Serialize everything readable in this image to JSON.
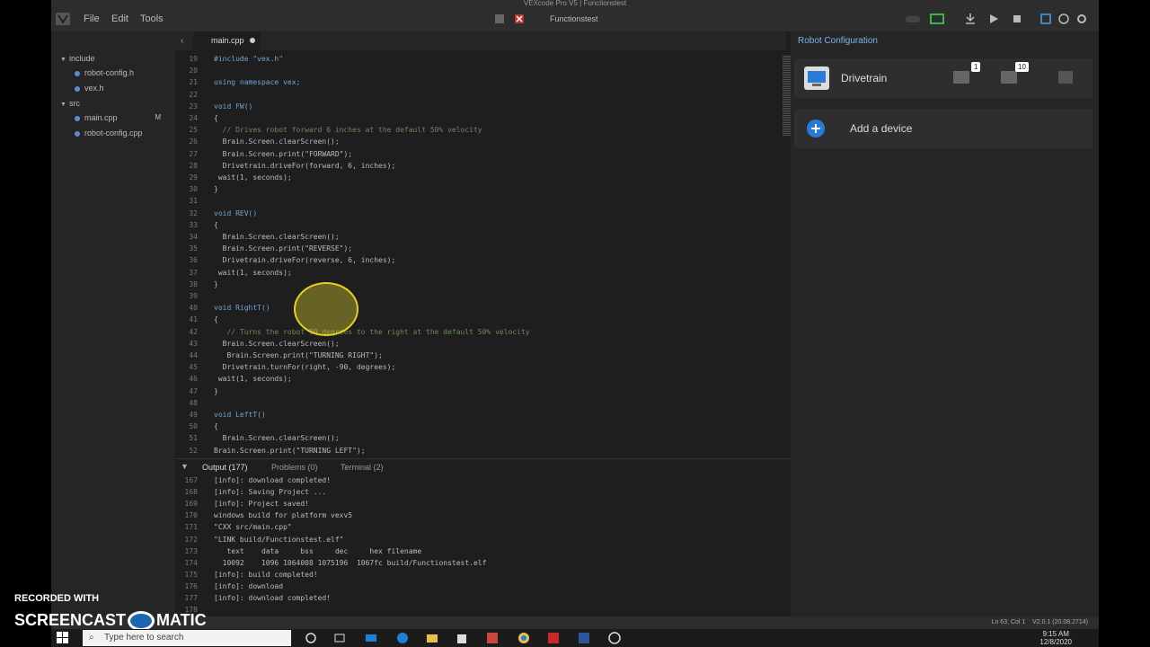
{
  "window": {
    "title": "VEXcode Pro V5 | Functionstest",
    "project_name": "Functionstest"
  },
  "menu": {
    "file": "File",
    "edit": "Edit",
    "tools": "Tools"
  },
  "sidebar": {
    "items": [
      {
        "label": "include",
        "type": "folder"
      },
      {
        "label": "robot-config.h",
        "type": "file"
      },
      {
        "label": "vex.h",
        "type": "file"
      },
      {
        "label": "src",
        "type": "folder"
      },
      {
        "label": "main.cpp",
        "type": "file",
        "badge": "M"
      },
      {
        "label": "robot-config.cpp",
        "type": "file"
      }
    ]
  },
  "editor": {
    "tab_label": "main.cpp",
    "lines": [
      {
        "n": "19",
        "text": "#include \"vex.h\""
      },
      {
        "n": "20",
        "text": ""
      },
      {
        "n": "21",
        "text": "using namespace vex;"
      },
      {
        "n": "22",
        "text": ""
      },
      {
        "n": "23",
        "text": "void FW()"
      },
      {
        "n": "24",
        "text": "{"
      },
      {
        "n": "25",
        "text": "  // Drives robot forward 6 inches at the default 50% velocity"
      },
      {
        "n": "26",
        "text": "  Brain.Screen.clearScreen();"
      },
      {
        "n": "27",
        "text": "  Brain.Screen.print(\"FORWARD\");"
      },
      {
        "n": "28",
        "text": "  Drivetrain.driveFor(forward, 6, inches);"
      },
      {
        "n": "29",
        "text": " wait(1, seconds);"
      },
      {
        "n": "30",
        "text": "}"
      },
      {
        "n": "31",
        "text": ""
      },
      {
        "n": "32",
        "text": "void REV()"
      },
      {
        "n": "33",
        "text": "{"
      },
      {
        "n": "34",
        "text": "  Brain.Screen.clearScreen();"
      },
      {
        "n": "35",
        "text": "  Brain.Screen.print(\"REVERSE\");"
      },
      {
        "n": "36",
        "text": "  Drivetrain.driveFor(reverse, 6, inches);"
      },
      {
        "n": "37",
        "text": " wait(1, seconds);"
      },
      {
        "n": "38",
        "text": "}"
      },
      {
        "n": "39",
        "text": ""
      },
      {
        "n": "40",
        "text": "void RightT()"
      },
      {
        "n": "41",
        "text": "{"
      },
      {
        "n": "42",
        "text": "   // Turns the robot 90 degrees to the right at the default 50% velocity"
      },
      {
        "n": "43",
        "text": "  Brain.Screen.clearScreen();"
      },
      {
        "n": "44",
        "text": "   Brain.Screen.print(\"TURNING RIGHT\");"
      },
      {
        "n": "45",
        "text": "  Drivetrain.turnFor(right, -90, degrees);"
      },
      {
        "n": "46",
        "text": " wait(1, seconds);"
      },
      {
        "n": "47",
        "text": "}"
      },
      {
        "n": "48",
        "text": ""
      },
      {
        "n": "49",
        "text": "void LeftT()"
      },
      {
        "n": "50",
        "text": "{"
      },
      {
        "n": "51",
        "text": "  Brain.Screen.clearScreen();"
      },
      {
        "n": "52",
        "text": "Brain.Screen.print(\"TURNING LEFT\");"
      }
    ]
  },
  "panel": {
    "tabs": [
      {
        "label": "Output (177)",
        "active": true
      },
      {
        "label": "Problems (0)",
        "active": false
      },
      {
        "label": "Terminal (2)",
        "active": false
      }
    ],
    "lines": [
      {
        "n": "167",
        "text": "[info]: download completed!"
      },
      {
        "n": "168",
        "text": "[info]: Saving Project ..."
      },
      {
        "n": "169",
        "text": "[info]: Project saved!"
      },
      {
        "n": "170",
        "text": "windows build for platform vexv5"
      },
      {
        "n": "171",
        "text": "\"CXX src/main.cpp\""
      },
      {
        "n": "172",
        "text": "\"LINK build/Functionstest.elf\""
      },
      {
        "n": "173",
        "text": "   text    data     bss     dec     hex filename"
      },
      {
        "n": "174",
        "text": "  10092    1096 1064008 1075196  1067fc build/Functionstest.elf"
      },
      {
        "n": "175",
        "text": "[info]: build completed!"
      },
      {
        "n": "176",
        "text": "[info]: download"
      },
      {
        "n": "177",
        "text": "[info]: download completed!"
      },
      {
        "n": "178",
        "text": ""
      }
    ]
  },
  "status": {
    "position": "Ln 63, Col 1",
    "version": "V2.0.1 (20.08.2714)"
  },
  "robot_config": {
    "title": "Robot Configuration",
    "drivetrain_label": "Drivetrain",
    "port_1": "1",
    "port_10": "10",
    "add_device_label": "Add a device"
  },
  "watermark": {
    "line1": "RECORDED WITH",
    "line2a": "SCREENCAST",
    "line2b": "MATIC"
  },
  "taskbar": {
    "search_placeholder": "Type here to search",
    "time": "9:15 AM",
    "date": "12/8/2020"
  },
  "colors": {
    "accent": "#7fb3e8",
    "comment": "#6a8a5a",
    "string": "#c8855f",
    "keyword": "#6fa6d8"
  }
}
